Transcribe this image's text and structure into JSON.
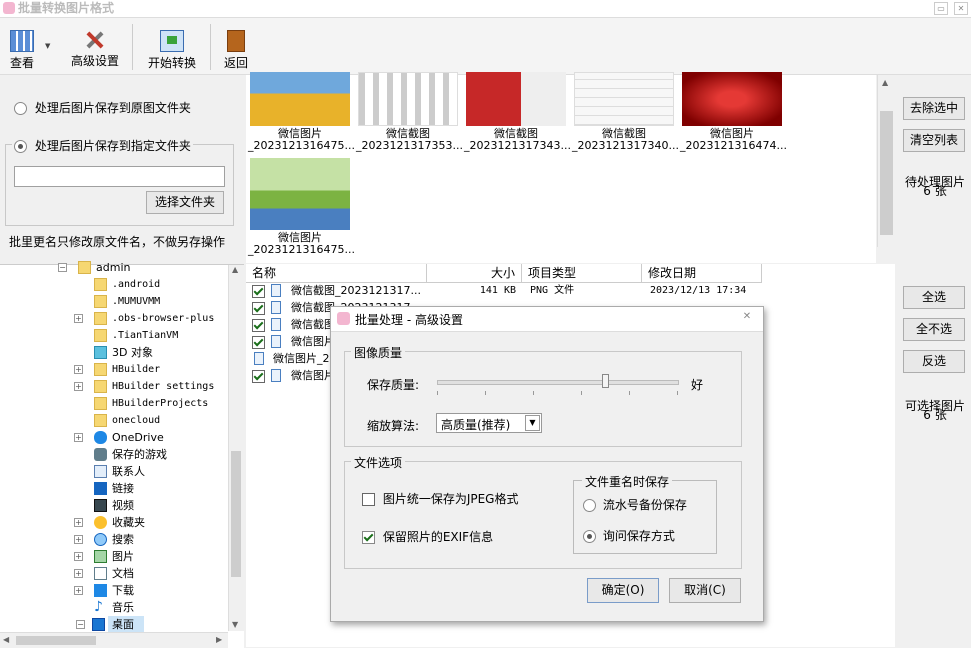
{
  "window": {
    "title": "批量转换图片格式"
  },
  "toolbar": {
    "view_label": "查看",
    "advanced_label": "高级设置",
    "start_label": "开始转换",
    "back_label": "返回"
  },
  "options": {
    "save_to_source": "处理后图片保存到原图文件夹",
    "save_to_folder": "处理后图片保存到指定文件夹",
    "folder_path": "",
    "choose_folder": "选择文件夹",
    "rename_note": "批里更名只修改原文件名，不做另存操作"
  },
  "tree": {
    "items": [
      {
        "label": "admin"
      },
      {
        "label": ".android"
      },
      {
        "label": ".MUMUVMM"
      },
      {
        "label": ".obs-browser-plus"
      },
      {
        "label": ".TianTianVM"
      },
      {
        "label": "3D 对象"
      },
      {
        "label": "HBuilder"
      },
      {
        "label": "HBuilder settings"
      },
      {
        "label": "HBuilderProjects"
      },
      {
        "label": "onecloud"
      },
      {
        "label": "OneDrive"
      },
      {
        "label": "保存的游戏"
      },
      {
        "label": "联系人"
      },
      {
        "label": "链接"
      },
      {
        "label": "视频"
      },
      {
        "label": "收藏夹"
      },
      {
        "label": "搜索"
      },
      {
        "label": "图片"
      },
      {
        "label": "文档"
      },
      {
        "label": "下载"
      },
      {
        "label": "音乐"
      },
      {
        "label": "桌面"
      }
    ]
  },
  "thumbs": [
    {
      "name": "微信图片",
      "file": "_2023121316475..."
    },
    {
      "name": "微信截图",
      "file": "_2023121317353..."
    },
    {
      "name": "微信截图",
      "file": "_2023121317343..."
    },
    {
      "name": "微信截图",
      "file": "_2023121317340..."
    },
    {
      "name": "微信图片",
      "file": "_2023121316474..."
    },
    {
      "name": "微信图片",
      "file": "_2023121316475..."
    }
  ],
  "right_top": {
    "remove_selected": "去除选中",
    "clear_list": "清空列表",
    "pending_label": "待处理图片",
    "pending_count": "6 张"
  },
  "right_bottom": {
    "select_all": "全选",
    "select_none": "全不选",
    "invert": "反选",
    "selectable_label": "可选择图片",
    "selectable_count": "6 张"
  },
  "filelist": {
    "headers": {
      "name": "名称",
      "size": "大小",
      "type": "项目类型",
      "date": "修改日期"
    },
    "rows": [
      {
        "name": "微信截图_2023121317...",
        "size": "141 KB",
        "type": "PNG 文件",
        "date": "2023/12/13 17:34"
      },
      {
        "name": "微信截图_2023121317...",
        "size": "",
        "type": "",
        "date": ""
      },
      {
        "name": "微信截图",
        "size": "",
        "type": "",
        "date": ""
      },
      {
        "name": "微信图片",
        "size": "",
        "type": "",
        "date": ""
      },
      {
        "name": "微信图片_2",
        "size": "",
        "type": "",
        "date": ""
      },
      {
        "name": "微信图片",
        "size": "",
        "type": "",
        "date": ""
      }
    ]
  },
  "dialog": {
    "title": "批量处理 - 高级设置",
    "quality_group": "图像质量",
    "quality_label": "保存质量:",
    "quality_value_label": "好",
    "quality_level": 0.7,
    "scale_label": "缩放算法:",
    "scale_value": "高质量(推荐)",
    "file_group": "文件选项",
    "jpeg_label": "图片统一保存为JPEG格式",
    "exif_label": "保留照片的EXIF信息",
    "rename_group": "文件重名时保存",
    "serial_label": "流水号备份保存",
    "ask_label": "询问保存方式",
    "ok_label": "确定(O)",
    "cancel_label": "取消(C)"
  },
  "colors": {
    "accent": "#1a6e1a",
    "check": "#1a6e1a",
    "folder": "#f6d772"
  }
}
